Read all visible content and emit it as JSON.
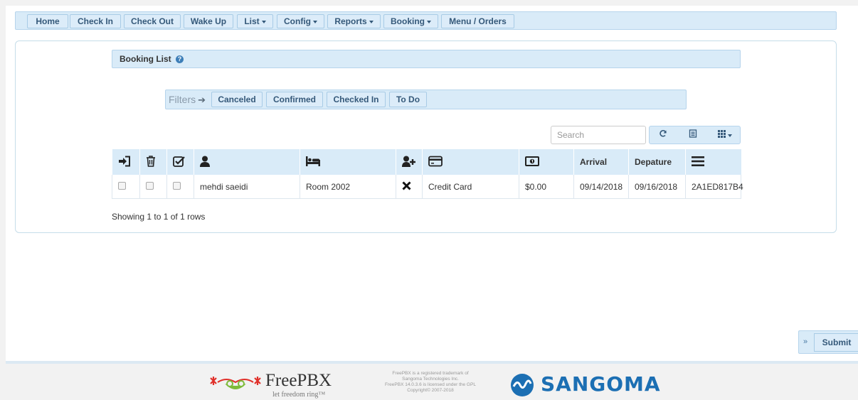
{
  "nav": {
    "home": "Home",
    "check_in": "Check In",
    "check_out": "Check Out",
    "wake_up": "Wake Up",
    "list": "List",
    "config": "Config",
    "reports": "Reports",
    "booking": "Booking",
    "menu_orders": "Menu / Orders"
  },
  "panel": {
    "title": "Booking List"
  },
  "filters": {
    "label": "Filters",
    "canceled": "Canceled",
    "confirmed": "Confirmed",
    "checked_in": "Checked In",
    "to_do": "To Do"
  },
  "toolbar": {
    "search_placeholder": "Search"
  },
  "table": {
    "headers": {
      "arrival": "Arrival",
      "departure": "Depature"
    },
    "rows": [
      {
        "guest": "mehdi saeidi",
        "room": "Room 2002",
        "payment": "Credit Card",
        "amount": "$0.00",
        "arrival": "09/14/2018",
        "departure": "09/16/2018",
        "code": "2A1ED817B4"
      }
    ]
  },
  "pagination": {
    "showing": "Showing 1 to 1 of 1 rows"
  },
  "submit": {
    "label": "Submit"
  },
  "footer": {
    "freepbx_name": "FreePBX",
    "freepbx_tagline": "let freedom ring™",
    "legal_1": "FreePBX is a registered trademark of",
    "legal_2": "Sangoma Technologies Inc.",
    "legal_3": "FreePBX 14.0.3.6 is licensed under the GPL",
    "legal_4": "Copyright© 2007-2018",
    "sangoma": "SANGOMA"
  },
  "colors": {
    "accent_bg": "#d9ebf8",
    "accent_border": "#b6d4ec",
    "brand_blue": "#1c6fb3"
  }
}
